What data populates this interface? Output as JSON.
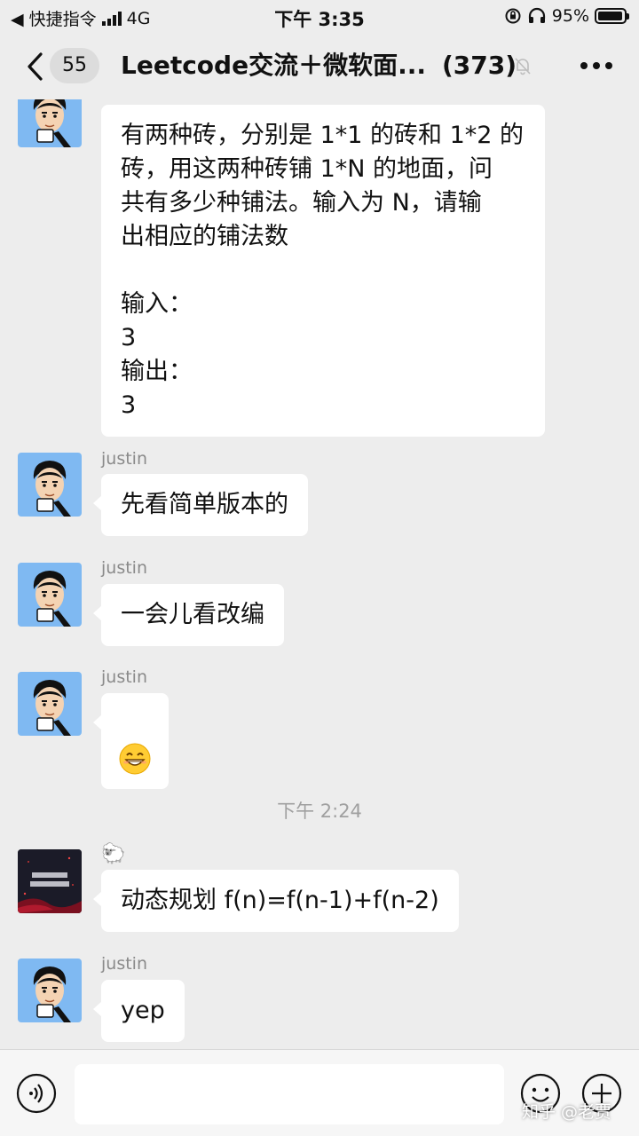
{
  "status_bar": {
    "carrier": "◀ 快捷指令",
    "network": "4G",
    "time": "下午 3:35",
    "battery_text": "95%",
    "battery_level": 0.95
  },
  "nav": {
    "unread_count": "55",
    "title": "Leetcode交流＋微软面...",
    "member_count": "(373)"
  },
  "messages": [
    {
      "sender": "",
      "text": "有两种砖，分别是 1*1 的砖和 1*2 的\n砖，用这两种砖铺 1*N 的地面，问\n共有多少种铺法。输入为 N，请输\n出相应的铺法数\n\n输入：\n3\n输出：\n3"
    },
    {
      "sender": "justin",
      "text": "先看简单版本的"
    },
    {
      "sender": "justin",
      "text": "一会儿看改编"
    },
    {
      "sender": "justin",
      "emoji": "grinning-face"
    },
    {
      "timestamp": "下午 2:24"
    },
    {
      "sender": "🐑",
      "text": "动态规划  f(n)=f(n-1)+f(n-2)"
    },
    {
      "sender": "justin",
      "text": "yep"
    }
  ],
  "watermark": "知乎 @老贾",
  "colors": {
    "background": "#ededed",
    "bubble": "#ffffff",
    "avatar_bg": "#7fb9f2",
    "timestamp": "#a0a0a0"
  }
}
